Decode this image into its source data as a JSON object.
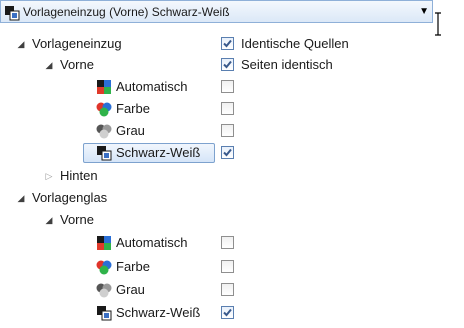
{
  "dropdown": {
    "selected": "Vorlageneinzug (Vorne) Schwarz-Weiß",
    "icon": "black-white-icon"
  },
  "options": {
    "identical_sources": {
      "label": "Identische Quellen",
      "checked": true
    },
    "identical_sides": {
      "label": "Seiten identisch",
      "checked": true
    }
  },
  "tree": {
    "feeder": {
      "label": "Vorlageneinzug",
      "front": {
        "label": "Vorne",
        "items": [
          {
            "label": "Automatisch",
            "icon": "automatic-color-icon",
            "checked": false
          },
          {
            "label": "Farbe",
            "icon": "color-icon",
            "checked": false
          },
          {
            "label": "Grau",
            "icon": "grayscale-icon",
            "checked": false
          },
          {
            "label": "Schwarz-Weiß",
            "icon": "black-white-icon",
            "checked": true,
            "selected": true
          }
        ]
      },
      "back": {
        "label": "Hinten"
      }
    },
    "flatbed": {
      "label": "Vorlagenglas",
      "front": {
        "label": "Vorne",
        "items": [
          {
            "label": "Automatisch",
            "icon": "automatic-color-icon",
            "checked": false
          },
          {
            "label": "Farbe",
            "icon": "color-icon",
            "checked": false
          },
          {
            "label": "Grau",
            "icon": "grayscale-icon",
            "checked": false
          },
          {
            "label": "Schwarz-Weiß",
            "icon": "black-white-icon",
            "checked": true
          }
        ]
      }
    }
  },
  "colors": {
    "selection_border": "#7da2ce",
    "checkbox_check": "#3a5a8c"
  }
}
